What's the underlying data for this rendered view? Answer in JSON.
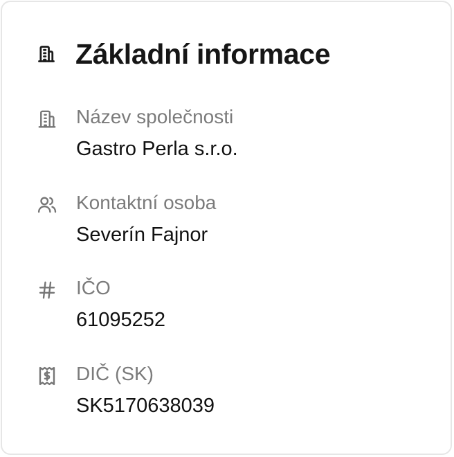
{
  "section": {
    "title": "Základní informace",
    "icon": "building-icon"
  },
  "fields": [
    {
      "icon": "building-icon",
      "label": "Název společnosti",
      "value": "Gastro Perla s.r.o."
    },
    {
      "icon": "users-icon",
      "label": "Kontaktní osoba",
      "value": "Severín Fajnor"
    },
    {
      "icon": "hash-icon",
      "label": "IČO",
      "value": "61095252"
    },
    {
      "icon": "receipt-icon",
      "label": "DIČ (SK)",
      "value": "SK5170638039"
    }
  ],
  "colors": {
    "title": "#161616",
    "label": "#7b7b7b",
    "value": "#111111",
    "icon": "#757575",
    "border": "#e6e6e6"
  }
}
